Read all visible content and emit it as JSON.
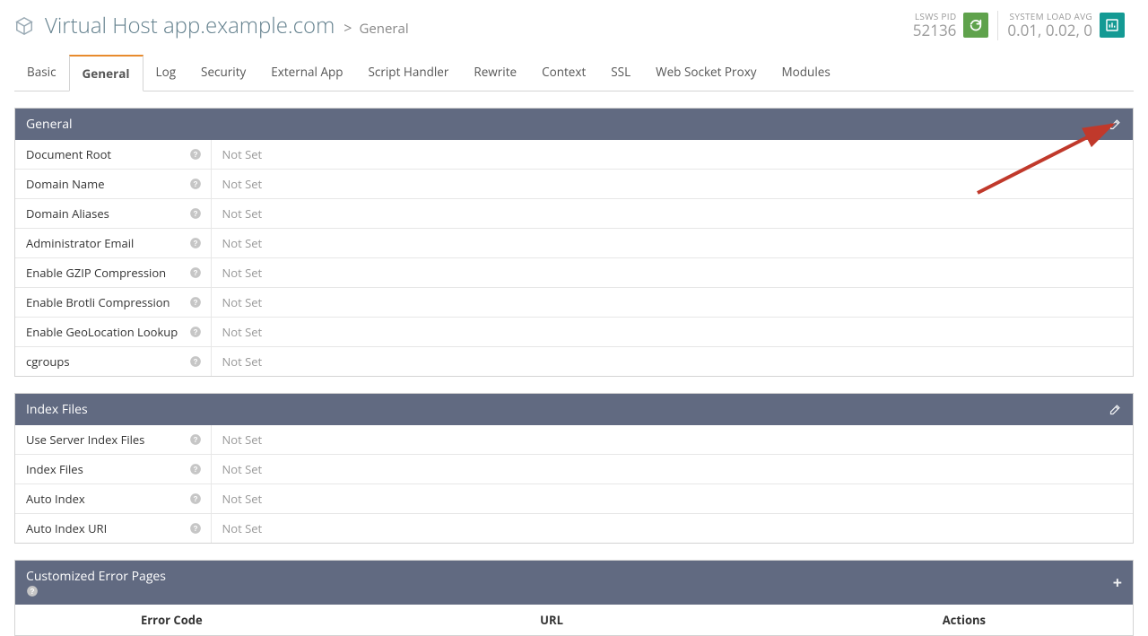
{
  "header": {
    "title": "Virtual Host app.example.com",
    "breadcrumb": "General",
    "pid_label": "LSWS PID",
    "pid_value": "52136",
    "load_label": "SYSTEM LOAD AVG",
    "load_value": "0.01, 0.02, 0"
  },
  "tabs": [
    {
      "label": "Basic",
      "active": false
    },
    {
      "label": "General",
      "active": true
    },
    {
      "label": "Log",
      "active": false
    },
    {
      "label": "Security",
      "active": false
    },
    {
      "label": "External App",
      "active": false
    },
    {
      "label": "Script Handler",
      "active": false
    },
    {
      "label": "Rewrite",
      "active": false
    },
    {
      "label": "Context",
      "active": false
    },
    {
      "label": "SSL",
      "active": false
    },
    {
      "label": "Web Socket Proxy",
      "active": false
    },
    {
      "label": "Modules",
      "active": false
    }
  ],
  "panels": {
    "general": {
      "title": "General",
      "rows": [
        {
          "label": "Document Root",
          "value": "Not Set"
        },
        {
          "label": "Domain Name",
          "value": "Not Set"
        },
        {
          "label": "Domain Aliases",
          "value": "Not Set"
        },
        {
          "label": "Administrator Email",
          "value": "Not Set"
        },
        {
          "label": "Enable GZIP Compression",
          "value": "Not Set"
        },
        {
          "label": "Enable Brotli Compression",
          "value": "Not Set"
        },
        {
          "label": "Enable GeoLocation Lookup",
          "value": "Not Set"
        },
        {
          "label": "cgroups",
          "value": "Not Set"
        }
      ]
    },
    "index": {
      "title": "Index Files",
      "rows": [
        {
          "label": "Use Server Index Files",
          "value": "Not Set"
        },
        {
          "label": "Index Files",
          "value": "Not Set"
        },
        {
          "label": "Auto Index",
          "value": "Not Set"
        },
        {
          "label": "Auto Index URI",
          "value": "Not Set"
        }
      ]
    },
    "errpages": {
      "title": "Customized Error Pages",
      "columns": {
        "code": "Error Code",
        "url": "URL",
        "actions": "Actions"
      }
    }
  }
}
